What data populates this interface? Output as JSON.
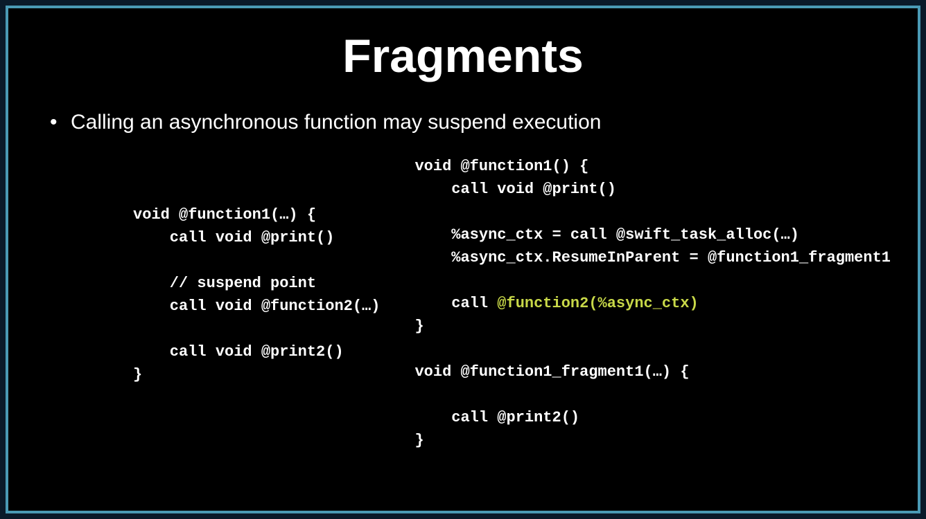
{
  "slide": {
    "title": "Fragments",
    "bullets": [
      "Calling an asynchronous function may suspend execution"
    ],
    "code_left": {
      "line0": "void @function1(…) {",
      "line1": "    call void @print()",
      "line2": "",
      "line3": "    // suspend point",
      "line4": "    call void @function2(…)",
      "line5": "",
      "line6": "    call void @print2()",
      "line7": "}"
    },
    "code_right_block1": {
      "line0": "void @function1() {",
      "line1": "    call void @print()",
      "line2": "",
      "line3": "    %async_ctx = call @swift_task_alloc(…)",
      "line4": "    %async_ctx.ResumeInParent = @function1_fragment1",
      "line5": "",
      "line6_prefix": "    call ",
      "line6_highlight": "@function2(%async_ctx)",
      "line7": "}"
    },
    "code_right_block2": {
      "line0": "void @function1_fragment1(…) {",
      "line1": "",
      "line2": "    call @print2()",
      "line3": "}"
    }
  }
}
